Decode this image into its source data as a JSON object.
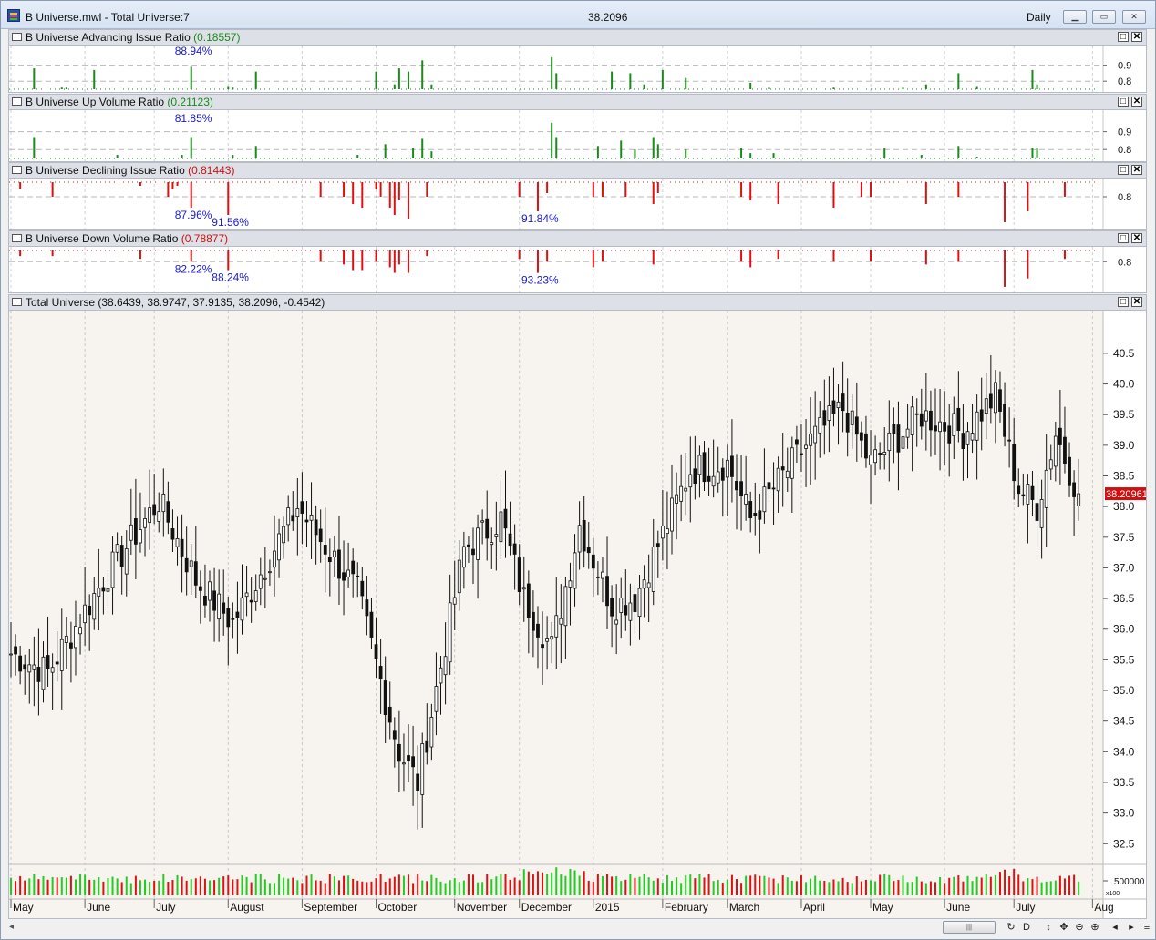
{
  "window": {
    "title": "B Universe.mwl - Total Universe:7",
    "last_price": "38.2096",
    "period": "Daily",
    "buttons": [
      "minimize",
      "restore",
      "close"
    ]
  },
  "panes": [
    {
      "id": "adv",
      "name": "B Universe Advancing Issue Ratio",
      "value": "(0.18557)",
      "value_color": "#1a8a1a"
    },
    {
      "id": "upv",
      "name": "B Universe Up Volume Ratio",
      "value": "(0.21123)",
      "value_color": "#1a8a1a"
    },
    {
      "id": "dec",
      "name": "B Universe Declining Issue Ratio",
      "value": "(0.81443)",
      "value_color": "#d01010"
    },
    {
      "id": "dnv",
      "name": "B Universe Down Volume Ratio",
      "value": "(0.78877)",
      "value_color": "#d01010"
    },
    {
      "id": "main",
      "name": "Total Universe",
      "value": "(38.6439, 38.9747, 37.9135, 38.2096, -0.4542)",
      "value_color": "#111111"
    }
  ],
  "colors": {
    "up": "#1a8a1a",
    "down": "#e01010",
    "annotation": "#1a1acc",
    "price_tag_bg": "#d01010",
    "price_tag_text": "#ffffff"
  },
  "chart_data": [
    {
      "type": "bar",
      "pane": "adv",
      "ylim": [
        0.75,
        1.0
      ],
      "yticks": [
        "0.9",
        "0.8"
      ],
      "threshold": 0.75,
      "bars": [
        [
          5,
          0.88
        ],
        [
          11,
          0.76
        ],
        [
          12,
          0.76
        ],
        [
          18,
          0.87
        ],
        [
          39,
          0.89
        ],
        [
          47,
          0.77
        ],
        [
          48,
          0.76
        ],
        [
          53,
          0.86
        ],
        [
          59,
          0.75
        ],
        [
          72,
          0.75
        ],
        [
          79,
          0.86
        ],
        [
          83,
          0.78
        ],
        [
          84,
          0.88
        ],
        [
          86,
          0.86
        ],
        [
          89,
          0.93
        ],
        [
          91,
          0.78
        ],
        [
          117,
          0.95
        ],
        [
          118,
          0.85
        ],
        [
          130,
          0.86
        ],
        [
          134,
          0.85
        ],
        [
          137,
          0.78
        ],
        [
          141,
          0.87
        ],
        [
          146,
          0.82
        ],
        [
          160,
          0.79
        ],
        [
          164,
          0.76
        ],
        [
          178,
          0.76
        ],
        [
          193,
          0.76
        ],
        [
          198,
          0.78
        ],
        [
          205,
          0.85
        ],
        [
          209,
          0.77
        ],
        [
          221,
          0.87
        ],
        [
          222,
          0.78
        ]
      ],
      "annotations": [
        {
          "label": "88.94%",
          "bar": 39
        }
      ]
    },
    {
      "type": "bar",
      "pane": "upv",
      "ylim": [
        0.75,
        1.0
      ],
      "yticks": [
        "0.9",
        "0.8"
      ],
      "threshold": 0.75,
      "bars": [
        [
          5,
          0.87
        ],
        [
          23,
          0.77
        ],
        [
          37,
          0.77
        ],
        [
          39,
          0.87
        ],
        [
          48,
          0.77
        ],
        [
          53,
          0.82
        ],
        [
          75,
          0.77
        ],
        [
          81,
          0.83
        ],
        [
          87,
          0.81
        ],
        [
          89,
          0.86
        ],
        [
          91,
          0.79
        ],
        [
          117,
          0.95
        ],
        [
          118,
          0.87
        ],
        [
          127,
          0.82
        ],
        [
          132,
          0.85
        ],
        [
          135,
          0.8
        ],
        [
          139,
          0.87
        ],
        [
          140,
          0.83
        ],
        [
          146,
          0.8
        ],
        [
          158,
          0.81
        ],
        [
          160,
          0.78
        ],
        [
          165,
          0.78
        ],
        [
          189,
          0.81
        ],
        [
          197,
          0.77
        ],
        [
          205,
          0.82
        ],
        [
          209,
          0.76
        ],
        [
          221,
          0.81
        ],
        [
          222,
          0.81
        ]
      ],
      "annotations": [
        {
          "label": "81.85%",
          "bar": 39
        }
      ]
    },
    {
      "type": "bar",
      "pane": "dec",
      "ylim": [
        0.72,
        0.84
      ],
      "yticks": [
        "0.8"
      ],
      "threshold": 0.84,
      "bars": [
        [
          2,
          0.82
        ],
        [
          9,
          0.8
        ],
        [
          28,
          0.83
        ],
        [
          34,
          0.8
        ],
        [
          35,
          0.82
        ],
        [
          36,
          0.83
        ],
        [
          39,
          0.77
        ],
        [
          47,
          0.75
        ],
        [
          67,
          0.8
        ],
        [
          72,
          0.8
        ],
        [
          74,
          0.78
        ],
        [
          76,
          0.77
        ],
        [
          79,
          0.82
        ],
        [
          80,
          0.8
        ],
        [
          82,
          0.77
        ],
        [
          83,
          0.75
        ],
        [
          84,
          0.79
        ],
        [
          86,
          0.74
        ],
        [
          90,
          0.8
        ],
        [
          110,
          0.8
        ],
        [
          114,
          0.76
        ],
        [
          116,
          0.81
        ],
        [
          126,
          0.8
        ],
        [
          128,
          0.8
        ],
        [
          133,
          0.8
        ],
        [
          139,
          0.78
        ],
        [
          140,
          0.81
        ],
        [
          158,
          0.8
        ],
        [
          160,
          0.79
        ],
        [
          166,
          0.78
        ],
        [
          178,
          0.77
        ],
        [
          184,
          0.8
        ],
        [
          186,
          0.8
        ],
        [
          198,
          0.78
        ],
        [
          205,
          0.8
        ],
        [
          215,
          0.73
        ],
        [
          220,
          0.76
        ],
        [
          228,
          0.8
        ]
      ],
      "annotations": [
        {
          "label": "87.96%",
          "bar": 39
        },
        {
          "label": "91.56%",
          "bar": 47
        },
        {
          "label": "91.84%",
          "bar": 114
        }
      ]
    },
    {
      "type": "bar",
      "pane": "dnv",
      "ylim": [
        0.7,
        0.84
      ],
      "yticks": [
        "0.8"
      ],
      "threshold": 0.84,
      "bars": [
        [
          2,
          0.82
        ],
        [
          9,
          0.82
        ],
        [
          28,
          0.81
        ],
        [
          39,
          0.8
        ],
        [
          47,
          0.77
        ],
        [
          67,
          0.8
        ],
        [
          72,
          0.79
        ],
        [
          74,
          0.77
        ],
        [
          76,
          0.77
        ],
        [
          79,
          0.8
        ],
        [
          82,
          0.78
        ],
        [
          83,
          0.76
        ],
        [
          84,
          0.79
        ],
        [
          86,
          0.76
        ],
        [
          90,
          0.82
        ],
        [
          110,
          0.81
        ],
        [
          114,
          0.76
        ],
        [
          116,
          0.8
        ],
        [
          126,
          0.78
        ],
        [
          128,
          0.8
        ],
        [
          139,
          0.79
        ],
        [
          158,
          0.8
        ],
        [
          160,
          0.78
        ],
        [
          166,
          0.81
        ],
        [
          178,
          0.8
        ],
        [
          186,
          0.8
        ],
        [
          198,
          0.79
        ],
        [
          205,
          0.8
        ],
        [
          215,
          0.71
        ],
        [
          220,
          0.74
        ],
        [
          228,
          0.81
        ]
      ],
      "annotations": [
        {
          "label": "82.22%",
          "bar": 39
        },
        {
          "label": "88.24%",
          "bar": 47
        },
        {
          "label": "93.23%",
          "bar": 114
        }
      ]
    },
    {
      "type": "ohlc",
      "pane": "main",
      "title": "Total Universe",
      "ylim": [
        32.4,
        40.9
      ],
      "yticks": [
        "40.5",
        "40.0",
        "39.5",
        "39.0",
        "38.5",
        "38.0",
        "37.5",
        "37.0",
        "36.5",
        "36.0",
        "35.5",
        "35.0",
        "34.5",
        "34.0",
        "33.5",
        "33.0",
        "32.5"
      ],
      "last_value_label": "38.20961",
      "last_value": 38.2096,
      "volume_label": "500000",
      "volume_multiplier": "x100",
      "xticks": [
        {
          "label": "May",
          "bar": 0
        },
        {
          "label": "June",
          "bar": 16
        },
        {
          "label": "July",
          "bar": 31
        },
        {
          "label": "August",
          "bar": 47
        },
        {
          "label": "September",
          "bar": 63
        },
        {
          "label": "October",
          "bar": 79
        },
        {
          "label": "November",
          "bar": 96
        },
        {
          "label": "December",
          "bar": 110
        },
        {
          "label": "2015",
          "bar": 126
        },
        {
          "label": "February",
          "bar": 141
        },
        {
          "label": "March",
          "bar": 155
        },
        {
          "label": "April",
          "bar": 171
        },
        {
          "label": "May",
          "bar": 186
        },
        {
          "label": "June",
          "bar": 202
        },
        {
          "label": "July",
          "bar": 217
        },
        {
          "label": "Aug",
          "bar": 234
        }
      ],
      "bars_total": 232,
      "pivots": [
        [
          0,
          35.6
        ],
        [
          8,
          35.3
        ],
        [
          20,
          36.8
        ],
        [
          32,
          38.1
        ],
        [
          40,
          36.8
        ],
        [
          48,
          36.1
        ],
        [
          62,
          38.0
        ],
        [
          75,
          36.6
        ],
        [
          84,
          34.0
        ],
        [
          88,
          33.5
        ],
        [
          98,
          37.3
        ],
        [
          106,
          37.8
        ],
        [
          111,
          36.5
        ],
        [
          117,
          35.7
        ],
        [
          123,
          37.7
        ],
        [
          130,
          36.4
        ],
        [
          135,
          36.5
        ],
        [
          147,
          38.6
        ],
        [
          155,
          38.7
        ],
        [
          160,
          37.8
        ],
        [
          172,
          39.0
        ],
        [
          180,
          39.6
        ],
        [
          186,
          38.7
        ],
        [
          197,
          39.5
        ],
        [
          206,
          39.2
        ],
        [
          213,
          39.8
        ],
        [
          218,
          38.3
        ],
        [
          222,
          38.0
        ],
        [
          226,
          39.2
        ],
        [
          231,
          38.2
        ]
      ]
    }
  ]
}
